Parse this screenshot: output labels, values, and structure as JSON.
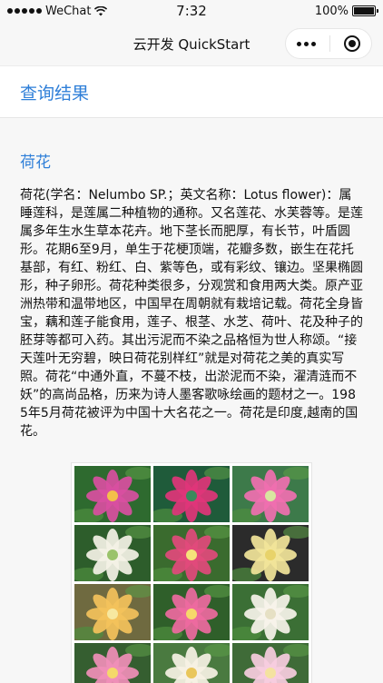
{
  "status_bar": {
    "carrier": "WeChat",
    "time": "7:32",
    "battery": "100%",
    "battery_level": 1.0
  },
  "nav": {
    "title": "云开发 QuickStart",
    "more_icon": "more-dots-icon",
    "close_icon": "target-circle-icon"
  },
  "result": {
    "heading": "查询结果",
    "name": "荷花",
    "description": "荷花(学名：Nelumbo SP.；英文名称：Lotus flower)：属睡莲科，是莲属二种植物的通称。又名莲花、水芙蓉等。是莲属多年生水生草本花卉。地下茎长而肥厚，有长节，叶盾圆形。花期6至9月，单生于花梗顶端，花瓣多数，嵌生在花托基部，有红、粉红、白、紫等色，或有彩纹、镶边。坚果椭圆形，种子卵形。荷花种类很多，分观赏和食用两大类。原产亚洲热带和温带地区，中国早在周朝就有栽培记载。荷花全身皆宝，藕和莲子能食用，莲子、根茎、水芝、荷叶、花及种子的胚芽等都可入药。其出污泥而不染之品格恒为世人称颂。“接天莲叶无穷碧，映日荷花别样红”就是对荷花之美的真实写照。荷花“中通外直，不蔓不枝，出淤泥而不染，濯清涟而不妖”的高尚品格，历来为诗人墨客歌咏绘画的题材之一。1985年5月荷花被评为中国十大名花之一。荷花是印度,越南的国花。"
  },
  "gallery_colors": [
    [
      "#d94fa1",
      "#f3c04a",
      "#2e6a2f"
    ],
    [
      "#e0357a",
      "#3a8a5c",
      "#1f5b3a"
    ],
    [
      "#f06fb0",
      "#d8e6a0",
      "#3d7a4a"
    ],
    [
      "#f4f2e6",
      "#9ac36b",
      "#2d5d2b"
    ],
    [
      "#e24a7c",
      "#f5e27a",
      "#3a6b2e"
    ],
    [
      "#f2e59a",
      "#e8d36a",
      "#2b2b2b"
    ],
    [
      "#f3c25b",
      "#f7e8a0",
      "#6f6a40"
    ],
    [
      "#ee6aa0",
      "#f6d86a",
      "#2f5f2a"
    ],
    [
      "#f7f3ea",
      "#e6e0c4",
      "#3b6f35"
    ],
    [
      "#f08fb8",
      "#f4d86a",
      "#355e30"
    ],
    [
      "#f6f1e4",
      "#e9c65b",
      "#4a7a40"
    ],
    [
      "#f7cde0",
      "#f4e2a0",
      "#3f6b38"
    ]
  ]
}
